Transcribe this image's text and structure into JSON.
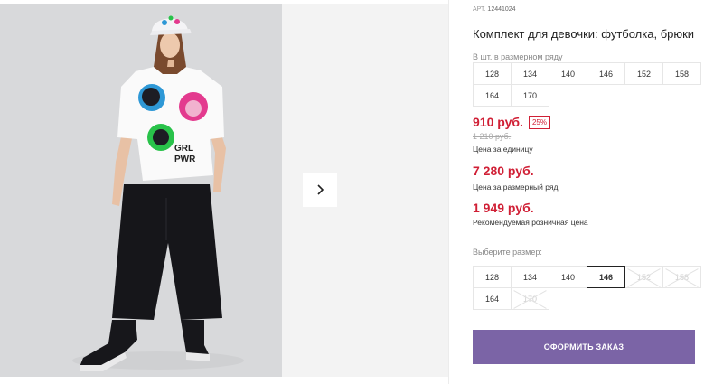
{
  "product": {
    "sku_label": "АРТ.",
    "sku_value": "12441024",
    "title": "Комплект для девочки: футболка, брюки"
  },
  "size_row": {
    "caption": "В шт. в размерном ряду",
    "sizes": [
      "128",
      "134",
      "140",
      "146",
      "152",
      "158",
      "164",
      "170"
    ]
  },
  "pricing": {
    "unit_price": "910 руб.",
    "discount": "25%",
    "old_price": "1 210 руб.",
    "unit_caption": "Цена за единицу",
    "row_price": "7 280 руб.",
    "row_caption": "Цена за размерный ряд",
    "rrp_price": "1 949 руб.",
    "rrp_caption": "Рекомендуемая розничная цена"
  },
  "size_picker": {
    "caption": "Выберите размер:",
    "selected": "146",
    "options": [
      {
        "label": "128",
        "state": "available"
      },
      {
        "label": "134",
        "state": "available"
      },
      {
        "label": "140",
        "state": "available"
      },
      {
        "label": "146",
        "state": "selected"
      },
      {
        "label": "152",
        "state": "disabled"
      },
      {
        "label": "158",
        "state": "disabled"
      },
      {
        "label": "164",
        "state": "available"
      },
      {
        "label": "170",
        "state": "disabled"
      }
    ]
  },
  "gallery": {
    "print_text_line1": "GRL",
    "print_text_line2": "PWR",
    "next_icon": "chevron-right-icon"
  },
  "actions": {
    "order_label": "ОФОРМИТЬ ЗАКАЗ"
  },
  "colors": {
    "accent_red": "#d01f35",
    "button_purple": "#7b64a6",
    "photo_bg": "#d8d9db"
  }
}
